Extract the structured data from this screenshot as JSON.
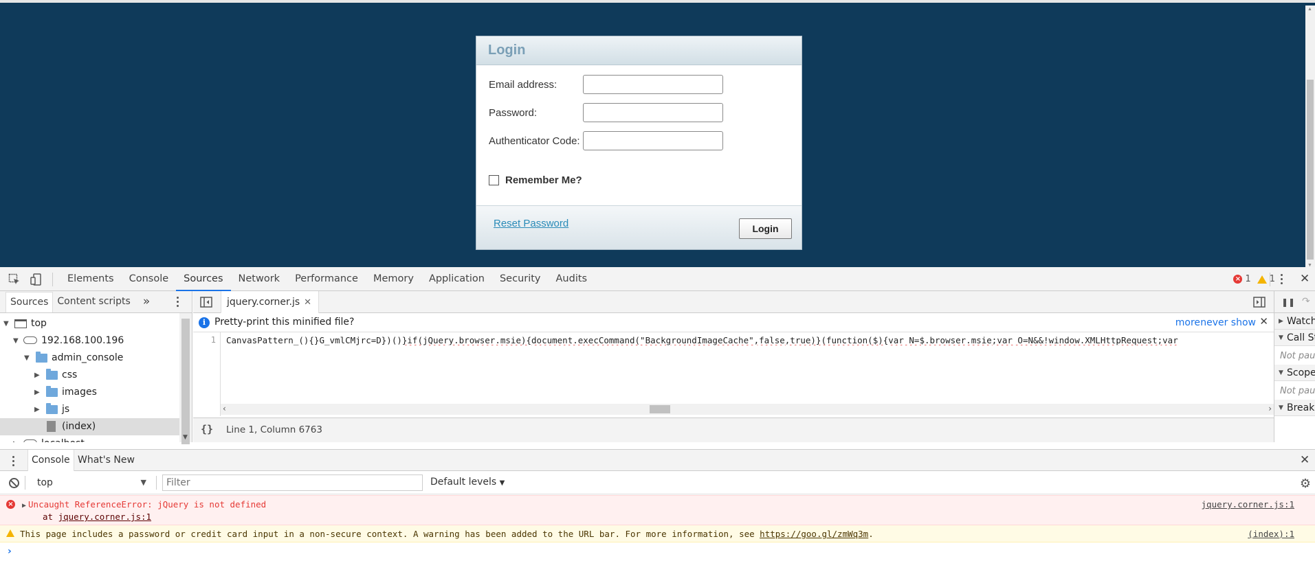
{
  "login": {
    "title": "Login",
    "email_label": "Email address:",
    "email_value": "",
    "password_label": "Password:",
    "password_value": "",
    "auth_label": "Authenticator Code:",
    "auth_value": "",
    "remember_label": "Remember Me?",
    "remember_checked": false,
    "reset_link": "Reset Password",
    "login_button": "Login"
  },
  "devtools": {
    "tabs": [
      "Elements",
      "Console",
      "Sources",
      "Network",
      "Performance",
      "Memory",
      "Application",
      "Security",
      "Audits"
    ],
    "active_tab": "Sources",
    "error_count": "1",
    "warning_count": "1",
    "navigator": {
      "tabs": [
        "Sources",
        "Content scripts"
      ],
      "more": "»",
      "tree": [
        {
          "label": "top",
          "depth": 0,
          "icon": "frame-icon",
          "expanded": true
        },
        {
          "label": "192.168.100.196",
          "depth": 1,
          "icon": "cloud-icon",
          "expanded": true
        },
        {
          "label": "admin_console",
          "depth": 2,
          "icon": "folder-icon",
          "expanded": true
        },
        {
          "label": "css",
          "depth": 3,
          "icon": "folder-icon",
          "expanded": false
        },
        {
          "label": "images",
          "depth": 3,
          "icon": "folder-icon",
          "expanded": false
        },
        {
          "label": "js",
          "depth": 3,
          "icon": "folder-icon",
          "expanded": false
        },
        {
          "label": "(index)",
          "depth": 3,
          "icon": "file-icon",
          "selected": true
        },
        {
          "label": "localhost",
          "depth": 1,
          "icon": "cloud-icon",
          "expanded": false
        }
      ]
    },
    "editor": {
      "file_tab": "jquery.corner.js",
      "pretty_print_prompt": "Pretty-print this minified file?",
      "more": "more",
      "never_show": "never show",
      "line_number": "1",
      "code_plain": "CanvasPattern_(){}G_vmlCMjrc=D})()",
      "code_squiggle": "}if(jQuery.browser.msie){document.execCommand(\"BackgroundImageCache\",false,true)}(function($){var N=$.browser.msie;var O=N&&!window.XMLHttpRequest;var",
      "cursor_position": "Line 1, Column 6763",
      "braces": "{}"
    },
    "debugger": {
      "sections": [
        "Watch",
        "Call Stack",
        "Scope",
        "Breakpoints"
      ],
      "not_paused": "Not paused"
    },
    "drawer": {
      "tabs": [
        "Console",
        "What's New"
      ],
      "context": "top",
      "filter_placeholder": "Filter",
      "levels": "Default levels",
      "messages": {
        "error_text": "Uncaught ReferenceError: jQuery is not defined",
        "error_at": "at ",
        "error_at_link": "jquery.corner.js:1",
        "error_source": "jquery.corner.js:1",
        "warning_text": "This page includes a password or credit card input in a non-secure context. A warning has been added to the URL bar. For more information, see ",
        "warning_link": "https://goo.gl/zmWq3m",
        "warning_period": ".",
        "warning_source": "(index):1"
      },
      "prompt": "›"
    }
  },
  "colors": {
    "page_background": "#0f3a5a",
    "accent": "#1a73e8",
    "error": "#e53935",
    "warning": "#f4b400"
  }
}
